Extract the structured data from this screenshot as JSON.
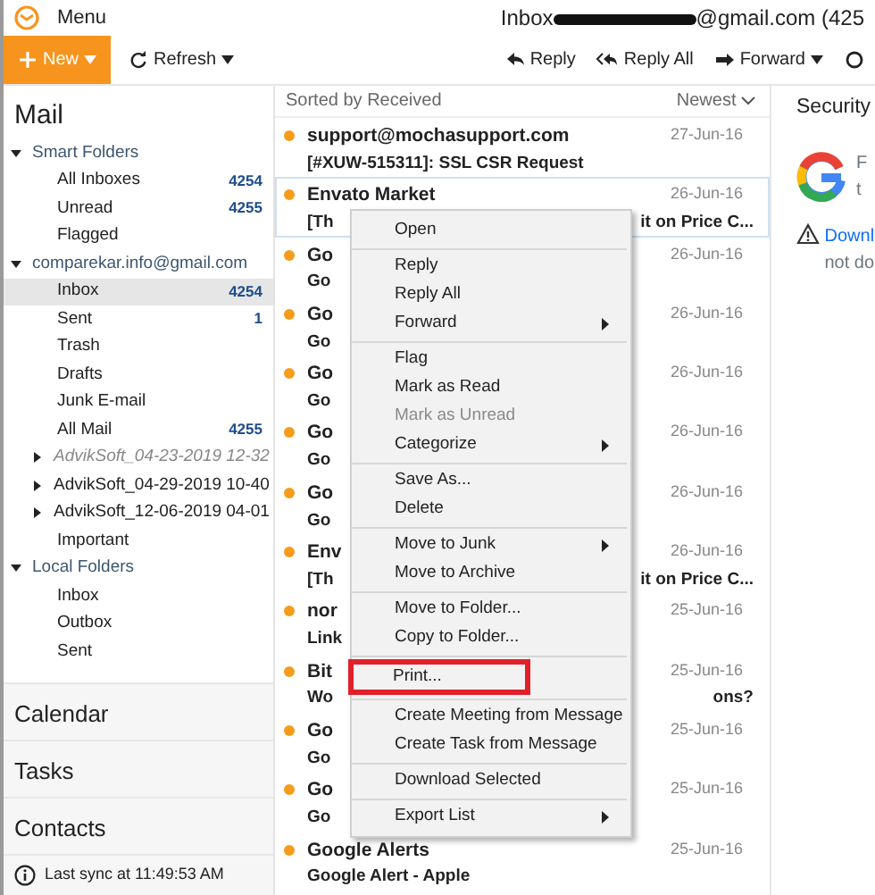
{
  "app_bar": {
    "menu_label": "Menu",
    "title_start": "Inbox",
    "title_redacted": true,
    "title_end": "@gmail.com (425"
  },
  "toolbar": {
    "left": [
      {
        "kind": "new",
        "label": "New",
        "has_menu": true
      },
      {
        "kind": "refresh",
        "label": "Refresh",
        "has_menu": true
      }
    ],
    "right": [
      {
        "kind": "reply",
        "label": "Reply",
        "has_menu": false
      },
      {
        "kind": "reply_all",
        "label": "Reply All",
        "has_menu": false
      },
      {
        "kind": "forward",
        "label": "Forward",
        "has_menu": true
      },
      {
        "kind": "more",
        "has_menu": false
      }
    ]
  },
  "sidebar": {
    "title": "Mail",
    "tree": [
      {
        "label": "Smart Folders",
        "expanded": true,
        "selected": false,
        "children": [
          {
            "label": "All Inboxes",
            "count": "4254",
            "selected": false
          },
          {
            "label": "Unread",
            "count": "4255",
            "selected": false
          },
          {
            "label": "Flagged",
            "selected": false
          }
        ]
      },
      {
        "label": "comparekar.info@gmail.com",
        "expanded": true,
        "selected": false,
        "children": [
          {
            "label": "Inbox",
            "count": "4254",
            "selected": true
          },
          {
            "label": "Sent",
            "count": "1",
            "selected": false
          },
          {
            "label": "Trash",
            "selected": false
          },
          {
            "label": "Drafts",
            "selected": false
          },
          {
            "label": "Junk E-mail",
            "selected": false
          },
          {
            "label": "All Mail",
            "count": "4255",
            "selected": false
          },
          {
            "label": "AdvikSoft_04-23-2019 12-32",
            "expanded": false,
            "dimmed": true,
            "selected": false
          },
          {
            "label": "AdvikSoft_04-29-2019 10-40",
            "expanded": false,
            "selected": false
          },
          {
            "label": "AdvikSoft_12-06-2019 04-01",
            "expanded": false,
            "selected": false
          },
          {
            "label": "Important",
            "selected": false
          }
        ]
      },
      {
        "label": "Local Folders",
        "expanded": true,
        "selected": false,
        "children": [
          {
            "label": "Inbox",
            "selected": false
          },
          {
            "label": "Outbox",
            "selected": false
          },
          {
            "label": "Sent",
            "selected": false
          }
        ]
      }
    ],
    "sections": [
      "Calendar",
      "Tasks",
      "Contacts"
    ],
    "status": "Last sync at 11:49:53 AM"
  },
  "message_list": {
    "sort_label": "Sorted by Received",
    "order_label": "Newest",
    "rows": [
      {
        "sender": "support@mochasupport.com",
        "subject": "[#XUW-515311]: SSL CSR Request",
        "date": "27-Jun-16",
        "unread": true,
        "selected": false
      },
      {
        "sender": "Envato Market",
        "subject": "[Th",
        "subject_tail": "it on Price C...",
        "date": "26-Jun-16",
        "unread": true,
        "selected": true
      },
      {
        "sender": "Go",
        "subject": "Go",
        "date": "26-Jun-16",
        "unread": true,
        "selected": false
      },
      {
        "sender": "Go",
        "subject": "Go",
        "date": "26-Jun-16",
        "unread": true,
        "selected": false
      },
      {
        "sender": "Go",
        "subject": "Go",
        "date": "26-Jun-16",
        "unread": true,
        "selected": false
      },
      {
        "sender": "Go",
        "subject": "Go",
        "date": "26-Jun-16",
        "unread": true,
        "selected": false
      },
      {
        "sender": "Go",
        "subject": "Go",
        "date": "26-Jun-16",
        "unread": true,
        "selected": false
      },
      {
        "sender": "Env",
        "subject": "[Th",
        "subject_tail": "it on Price C...",
        "date": "26-Jun-16",
        "unread": true,
        "selected": false
      },
      {
        "sender": "nor",
        "subject": "Link",
        "date": "25-Jun-16",
        "unread": true,
        "selected": false
      },
      {
        "sender": "Bit",
        "subject": "Wo",
        "subject_tail": "ons?",
        "date": "25-Jun-16",
        "unread": true,
        "selected": false
      },
      {
        "sender": "Go",
        "subject": "Go",
        "date": "25-Jun-16",
        "unread": true,
        "selected": false
      },
      {
        "sender": "Go",
        "subject": "Go",
        "date": "25-Jun-16",
        "unread": true,
        "selected": false
      },
      {
        "sender": "Google Alerts",
        "subject": "Google Alert - Apple",
        "date": "25-Jun-16",
        "unread": true,
        "selected": false
      }
    ]
  },
  "preview": {
    "title": "Security",
    "line_1": "F",
    "line_2": "t",
    "warning_1": "Downl",
    "warning_2": "not do"
  },
  "context_menu": {
    "groups": [
      [
        {
          "label": "Open",
          "submenu": false,
          "disabled": false,
          "highlighted": false
        }
      ],
      [
        {
          "label": "Reply",
          "submenu": false,
          "disabled": false,
          "highlighted": false
        },
        {
          "label": "Reply All",
          "submenu": false,
          "disabled": false,
          "highlighted": false
        },
        {
          "label": "Forward",
          "submenu": true,
          "disabled": false,
          "highlighted": false
        }
      ],
      [
        {
          "label": "Flag",
          "submenu": false,
          "disabled": false,
          "highlighted": false
        },
        {
          "label": "Mark as Read",
          "submenu": false,
          "disabled": false,
          "highlighted": false
        },
        {
          "label": "Mark as Unread",
          "submenu": false,
          "disabled": true,
          "highlighted": false
        },
        {
          "label": "Categorize",
          "submenu": true,
          "disabled": false,
          "highlighted": false
        }
      ],
      [
        {
          "label": "Save As...",
          "submenu": false,
          "disabled": false,
          "highlighted": false
        },
        {
          "label": "Delete",
          "submenu": false,
          "disabled": false,
          "highlighted": false
        }
      ],
      [
        {
          "label": "Move to Junk",
          "submenu": true,
          "disabled": false,
          "highlighted": false
        },
        {
          "label": "Move to Archive",
          "submenu": false,
          "disabled": false,
          "highlighted": false
        }
      ],
      [
        {
          "label": "Move to Folder...",
          "submenu": false,
          "disabled": false,
          "highlighted": false
        },
        {
          "label": "Copy to Folder...",
          "submenu": false,
          "disabled": false,
          "highlighted": false
        }
      ],
      [
        {
          "label": "Print...",
          "submenu": false,
          "disabled": false,
          "highlighted": true
        }
      ],
      [
        {
          "label": "Create Meeting from Message",
          "submenu": false,
          "disabled": false,
          "highlighted": false
        },
        {
          "label": "Create Task from Message",
          "submenu": false,
          "disabled": false,
          "highlighted": false
        }
      ],
      [
        {
          "label": "Download Selected",
          "submenu": false,
          "disabled": false,
          "highlighted": false
        }
      ],
      [
        {
          "label": "Export List",
          "submenu": true,
          "disabled": false,
          "highlighted": false
        }
      ]
    ]
  }
}
